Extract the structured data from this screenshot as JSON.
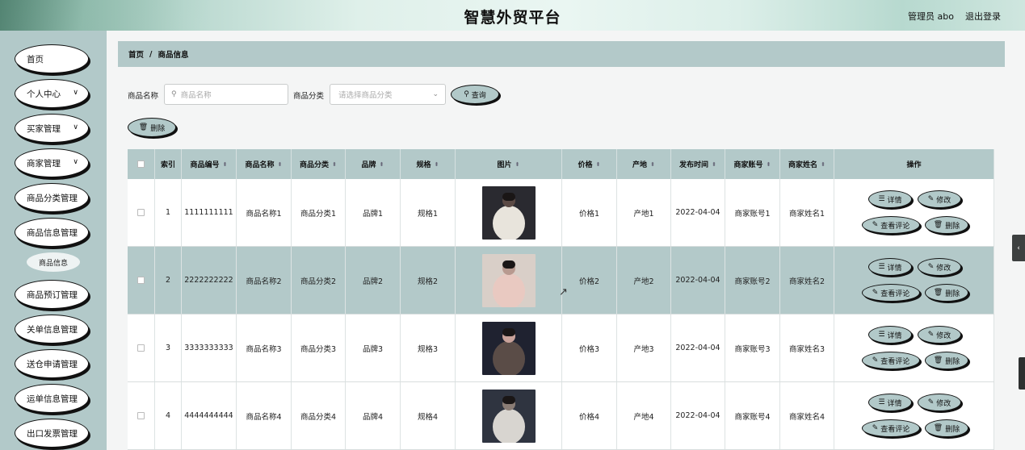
{
  "header": {
    "title": "智慧外贸平台",
    "user": "管理员 abo",
    "logout": "退出登录"
  },
  "sidebar": {
    "items": [
      {
        "label": "首页",
        "has_chevron": false
      },
      {
        "label": "个人中心",
        "has_chevron": true
      },
      {
        "label": "买家管理",
        "has_chevron": true
      },
      {
        "label": "商家管理",
        "has_chevron": true
      },
      {
        "label": "商品分类管理",
        "has_chevron": false
      },
      {
        "label": "商品信息管理",
        "has_chevron": false
      },
      {
        "label": "商品预订管理",
        "has_chevron": false
      },
      {
        "label": "关单信息管理",
        "has_chevron": false
      },
      {
        "label": "送仓申请管理",
        "has_chevron": false
      },
      {
        "label": "运单信息管理",
        "has_chevron": false
      },
      {
        "label": "出口发票管理",
        "has_chevron": false
      }
    ],
    "sub_item": "商品信息",
    "chevron_icon": "chevron-down-icon"
  },
  "breadcrumb": {
    "home": "首页",
    "separator": "/",
    "current": "商品信息"
  },
  "search": {
    "name_label": "商品名称",
    "name_placeholder": "商品名称",
    "category_label": "商品分类",
    "category_placeholder": "请选择商品分类",
    "query_button": "查询",
    "delete_button": "删除"
  },
  "table": {
    "columns": [
      "索引",
      "商品编号",
      "商品名称",
      "商品分类",
      "品牌",
      "规格",
      "图片",
      "价格",
      "产地",
      "发布时间",
      "商家账号",
      "商家姓名",
      "操作"
    ],
    "rows": [
      {
        "index": "1",
        "code": "1111111111",
        "name": "商品名称1",
        "category": "商品分类1",
        "brand": "品牌1",
        "spec": "规格1",
        "price": "价格1",
        "origin": "产地1",
        "date": "2022-04-04",
        "account": "商家账号1",
        "merchant": "商家姓名1",
        "image": "fur-coat-photo"
      },
      {
        "index": "2",
        "code": "2222222222",
        "name": "商品名称2",
        "category": "商品分类2",
        "brand": "品牌2",
        "spec": "规格2",
        "price": "价格2",
        "origin": "产地2",
        "date": "2022-04-04",
        "account": "商家账号2",
        "merchant": "商家姓名2",
        "image": "fur-coat-photo"
      },
      {
        "index": "3",
        "code": "3333333333",
        "name": "商品名称3",
        "category": "商品分类3",
        "brand": "品牌3",
        "spec": "规格3",
        "price": "价格3",
        "origin": "产地3",
        "date": "2022-04-04",
        "account": "商家账号3",
        "merchant": "商家姓名3",
        "image": "fur-coat-photo"
      },
      {
        "index": "4",
        "code": "4444444444",
        "name": "商品名称4",
        "category": "商品分类4",
        "brand": "品牌4",
        "spec": "规格4",
        "price": "价格4",
        "origin": "产地4",
        "date": "2022-04-04",
        "account": "商家账号4",
        "merchant": "商家姓名4",
        "image": "fur-coat-photo"
      }
    ],
    "actions": {
      "detail": "详情",
      "edit": "修改",
      "comments": "查看评论",
      "delete": "删除"
    }
  },
  "colors": {
    "accent": "#b3c9c9",
    "outline": "#111111",
    "background": "#f4f5f5"
  }
}
